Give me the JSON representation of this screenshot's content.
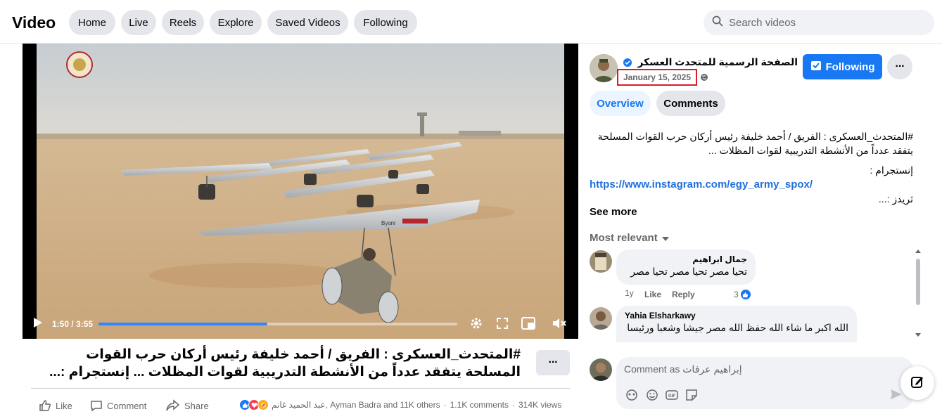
{
  "header": {
    "title": "Video",
    "nav": [
      "Home",
      "Live",
      "Reels",
      "Explore",
      "Saved Videos",
      "Following"
    ],
    "search_placeholder": "Search videos"
  },
  "player": {
    "current_time": "1:50",
    "duration": "3:55",
    "progress_fraction": 0.47,
    "wing_text": "Byoni"
  },
  "video": {
    "title": "#المتحدث_العسكرى : الفريق / أحمد خليفة رئيس أركان حرب القوات المسلحة يتفقد عدداً من الأنشطة التدريبية لقوات المظلات ... إنستجرام :...",
    "more_label": "···",
    "actions": {
      "like": "Like",
      "comment": "Comment",
      "share": "Share"
    },
    "reactions_text": "عبد الحميد غانم, Ayman Badra and 11K others",
    "comments_count": "1.1K comments",
    "views": "314K views"
  },
  "page": {
    "name": "الصفحة الرسمية للمتحدث العسكرى...",
    "date": "January 15, 2025",
    "follow_label": "Following",
    "more_label": "···"
  },
  "tabs": {
    "overview": "Overview",
    "comments": "Comments"
  },
  "description": {
    "text": "#المتحدث_العسكرى : الفريق / أحمد خليفة رئيس أركان حرب القوات المسلحة يتفقد عدداً من الأنشطة التدريبية لقوات المظلات ...",
    "instagram_label": "إنستجرام :",
    "instagram_link": "https://www.instagram.com/egy_army_spox/",
    "threads_label": "ثريدز :...",
    "see_more": "See more"
  },
  "comments": {
    "sort_label": "Most relevant",
    "items": [
      {
        "author": "جمال ابراهيم",
        "text": "تحيا مصر تحيا مصر تحيا مصر",
        "age": "1y",
        "like": "Like",
        "reply": "Reply",
        "reactions": "3"
      },
      {
        "author": "Yahia Elsharkawy",
        "text": "الله اكبر ما شاء الله حفظ الله مصر جيشا وشعبا ورئيسا"
      }
    ],
    "composer_placeholder": "Comment as إبراهيم عرفات"
  },
  "colors": {
    "accent": "#1877f2",
    "pill_bg": "#e4e6eb",
    "date_highlight": "#d61f26",
    "link": "#216fdb"
  }
}
